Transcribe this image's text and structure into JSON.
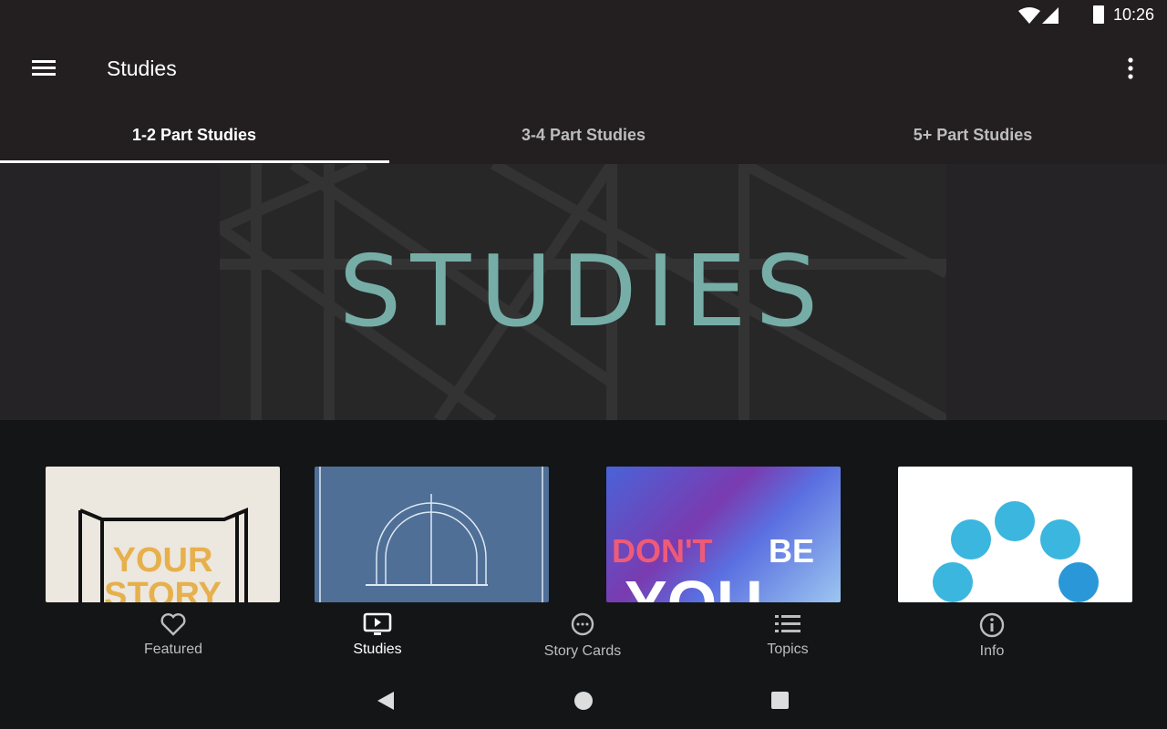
{
  "status": {
    "time": "10:26"
  },
  "toolbar": {
    "title": "Studies"
  },
  "tabs": [
    {
      "label": "1-2 Part Studies",
      "active": true
    },
    {
      "label": "3-4 Part Studies"
    },
    {
      "label": "5+ Part Studies"
    }
  ],
  "banner": {
    "title": "STUDIES"
  },
  "cards": [
    {
      "name": "your-story",
      "text1": "YOUR",
      "text2": "STORY"
    },
    {
      "name": "blueprint-arch"
    },
    {
      "name": "dont-be-you",
      "text1": "DON'T",
      "text2": "BE",
      "text3": "YOU"
    },
    {
      "name": "dots-arc"
    }
  ],
  "bottom_nav": [
    {
      "label": "Featured"
    },
    {
      "label": "Studies",
      "active": true
    },
    {
      "label": "Story Cards"
    },
    {
      "label": "Topics"
    },
    {
      "label": "Info"
    }
  ],
  "colors": {
    "accent": "#76aea7",
    "header": "#231f20",
    "background": "#141517"
  }
}
